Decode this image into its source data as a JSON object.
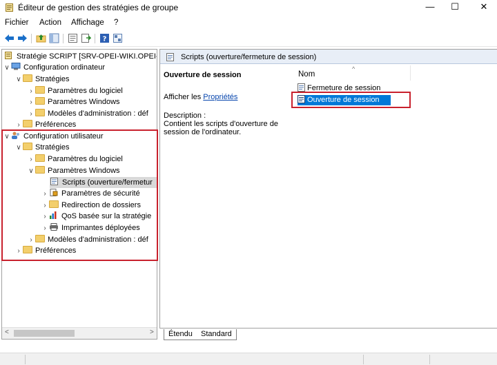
{
  "window": {
    "title": "Éditeur de gestion des stratégies de groupe",
    "minimize": "—",
    "maximize": "☐",
    "close": "✕"
  },
  "menu": [
    "Fichier",
    "Action",
    "Affichage",
    "?"
  ],
  "tree": {
    "root": "Stratégie SCRIPT [SRV-OPEI-WIKI.OPEI-W",
    "computer_config": "Configuration ordinateur",
    "computer_strategies": "Stratégies",
    "computer_software": "Paramètres du logiciel",
    "computer_windows": "Paramètres Windows",
    "computer_admin": "Modèles d'administration : déf",
    "computer_prefs": "Préférences",
    "user_config": "Configuration utilisateur",
    "user_strategies": "Stratégies",
    "user_software": "Paramètres du logiciel",
    "user_windows": "Paramètres Windows",
    "user_scripts": "Scripts (ouverture/fermetur",
    "user_security": "Paramètres de sécurité",
    "user_redirect": "Redirection de dossiers",
    "user_qos": "QoS basée sur la stratégie",
    "user_printers": "Imprimantes déployées",
    "user_admin": "Modèles d'administration : déf",
    "user_prefs": "Préférences"
  },
  "right": {
    "header": "Scripts (ouverture/fermeture de session)",
    "selected_title": "Ouverture de session",
    "props_prefix": "Afficher les ",
    "props_link": "Propriétés",
    "desc_label": "Description :",
    "desc_text": "Contient les scripts d'ouverture de session de l'ordinateur.",
    "column_name": "Nom",
    "items": [
      "Fermeture de session",
      "Ouverture de session"
    ]
  },
  "tabs": [
    "Étendu",
    "Standard"
  ],
  "colors": {
    "selection": "#0078d7",
    "highlight": "#c8202c",
    "link": "#0645ad"
  }
}
